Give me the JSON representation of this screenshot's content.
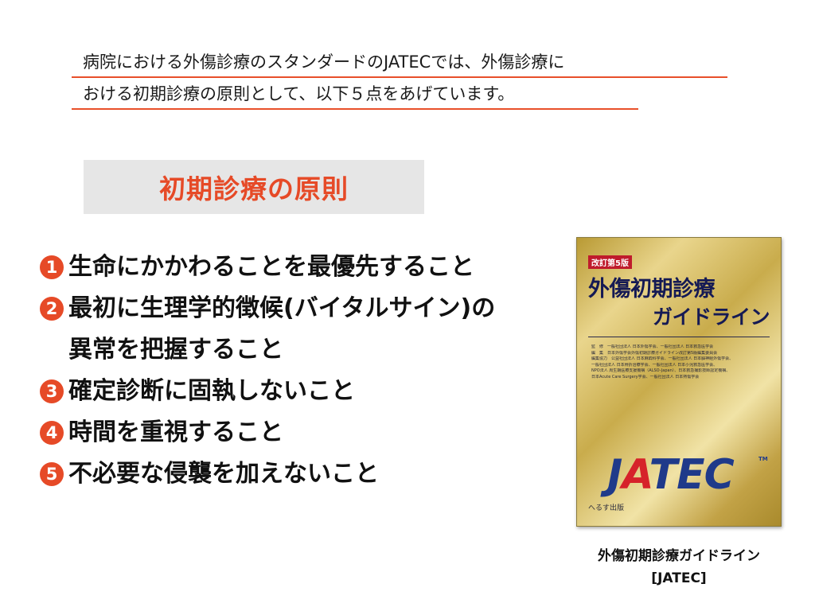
{
  "intro": {
    "line1": "病院における外傷診療のスタンダードのJATECでは、外傷診療に",
    "line2": "おける初期診療の原則として、以下５点をあげています。"
  },
  "heading": "初期診療の原則",
  "principles": [
    {
      "number": "1",
      "text": "生命にかかわることを最優先すること",
      "continuation": ""
    },
    {
      "number": "2",
      "text": "最初に生理学的徴候(バイタルサイン)の",
      "continuation": "異常を把握すること"
    },
    {
      "number": "3",
      "text": "確定診断に固執しないこと",
      "continuation": ""
    },
    {
      "number": "4",
      "text": "時間を重視すること",
      "continuation": ""
    },
    {
      "number": "5",
      "text": "不必要な侵襲を加えないこと",
      "continuation": ""
    }
  ],
  "book": {
    "edition": "改訂第5版",
    "title_line1": "外傷初期診療",
    "title_line2": "ガイドライン",
    "credits": [
      "監　修　一般社団法人 日本外傷学会、一般社団法人 日本救急医学会",
      "編　集　日本外傷学会外傷初期診療ガイドライン改訂第5版編集委員会",
      "編集協力　公益社団法人 日本麻酔科学会、一般社団法人 日本脳神経外傷学会、",
      "一般社団法人 日本骨折治療学会、一般社団法人 日本小児救急医学会、",
      "NPO法人 周生期医療支援機構（ALSO-Japan）、日本救急撮影技師認定機構、",
      "日本Acute Care Surgery学会、一般社団法人 日本熱傷学会"
    ],
    "logo_part1": "J",
    "logo_part2": "A",
    "logo_part3": "TEC",
    "tm": "TM",
    "publisher": "へるす出版"
  },
  "caption": {
    "line1": "外傷初期診療ガイドライン",
    "line2": "[JATEC]"
  },
  "colors": {
    "accent": "#e64a27",
    "underline": "#e8502a",
    "heading_bg": "#e6e6e6"
  }
}
